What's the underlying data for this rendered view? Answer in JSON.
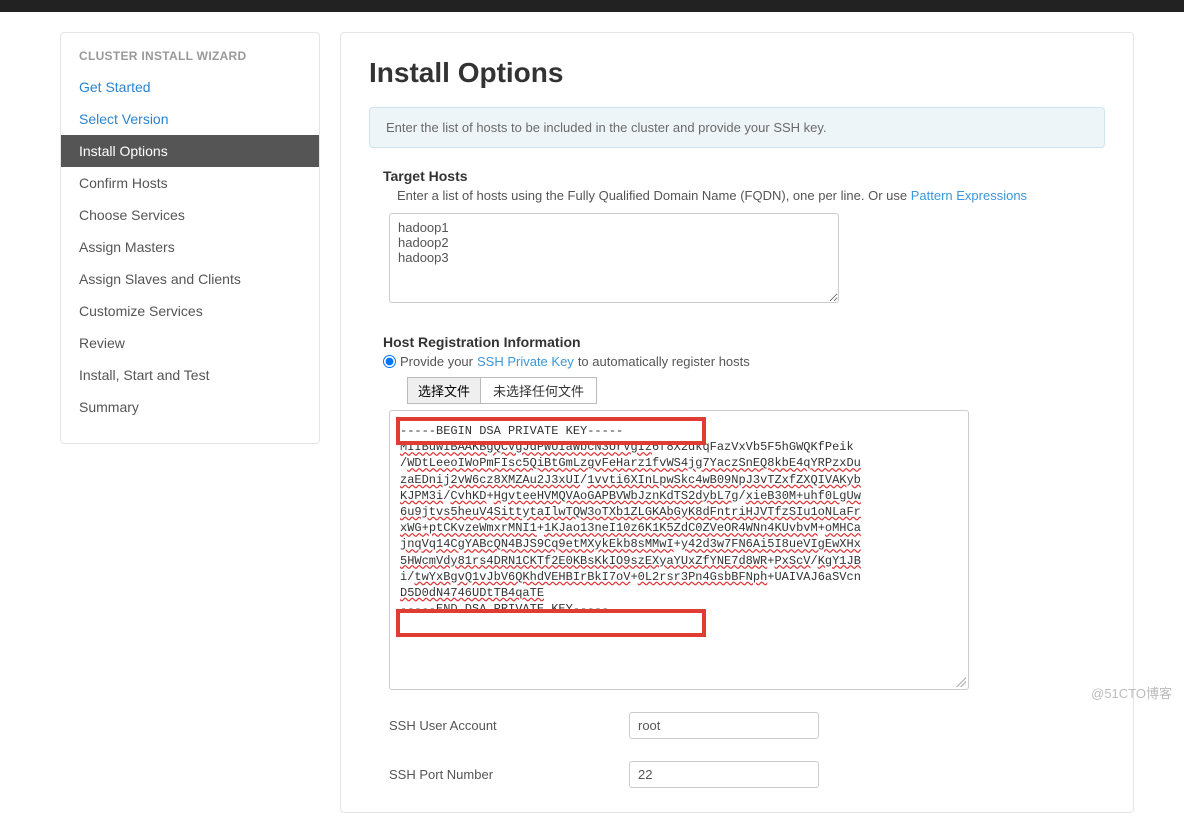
{
  "sidebar": {
    "title": "CLUSTER INSTALL WIZARD",
    "items": [
      {
        "label": "Get Started",
        "state": "link"
      },
      {
        "label": "Select Version",
        "state": "link"
      },
      {
        "label": "Install Options",
        "state": "active"
      },
      {
        "label": "Confirm Hosts",
        "state": "normal"
      },
      {
        "label": "Choose Services",
        "state": "normal"
      },
      {
        "label": "Assign Masters",
        "state": "normal"
      },
      {
        "label": "Assign Slaves and Clients",
        "state": "normal"
      },
      {
        "label": "Customize Services",
        "state": "normal"
      },
      {
        "label": "Review",
        "state": "normal"
      },
      {
        "label": "Install, Start and Test",
        "state": "normal"
      },
      {
        "label": "Summary",
        "state": "normal"
      }
    ]
  },
  "page": {
    "title": "Install Options",
    "info": "Enter the list of hosts to be included in the cluster and provide your SSH key."
  },
  "target_hosts": {
    "label": "Target Hosts",
    "desc_prefix": "Enter a list of hosts using the Fully Qualified Domain Name (FQDN), one per line. Or use ",
    "desc_link": "Pattern Expressions",
    "value": "hadoop1\nhadoop2\nhadoop3"
  },
  "host_reg": {
    "label": "Host Registration Information",
    "radio_prefix": "Provide your ",
    "radio_link": "SSH Private Key",
    "radio_suffix": " to automatically register hosts",
    "file_button": "选择文件",
    "file_status": "未选择任何文件",
    "key_begin": "-----BEGIN DSA PRIVATE KEY-----",
    "key_line1a": "MIIBuwIBAAKBgQCVgJdPWUIaWbcN3UrVgIz",
    "key_line1b": "6f8X2dkqFazVxVb5F5hGWQKfPeik",
    "key_line2a": "/",
    "key_line2b": "WDtLeeoIWoPmFIsc5QiBtGmLzgvFeHarz1fvWS4jg7YaczSnEQ8kbE4qYRPzxDu",
    "key_line3a": "zaEDnij2vW6cz8XMZAu2J3xUI",
    "key_line3b": "/",
    "key_line3c": "1vvti6XInLpwSkc4wB09NpJ3vTZxfZXQIVAKyb",
    "key_line4a": "KJPM3i",
    "key_line4b": "/",
    "key_line4c": "CvhKD",
    "key_line4d": "+",
    "key_line4e": "HgvteeHVMQVAoGAPBVWbJznKdTS2dybL7g",
    "key_line4f": "/",
    "key_line4g": "xieB30M+uhf0LgUw",
    "key_line5": "6u9jtvs5heuV4SittytaIlwTQW3oTXb1ZLGKAbGyK8dFntriHJVTfzSIu1oNLaFr",
    "key_line6a": "xWG+",
    "key_line6b": "ptCKvzeWmxrMNI1",
    "key_line6c": "+",
    "key_line6d": "1KJao13neI10z6K1K5ZdC0ZVeOR4WNn4KUvbvM",
    "key_line6e": "+",
    "key_line6f": "oMHCa",
    "key_line7a": "jnqVq14CgYABcQN4BJS9Cq9etMXykEkb8sMMwI",
    "key_line7b": "+",
    "key_line7c": "y42d3w7FN6Ai5I8ueVIgEwXHx",
    "key_line8a": "5HWcmVdy81rs4DRN1CKTf2E0KBsKkIO9szEXyaYUxZfYNE7d8WR",
    "key_line8b": "+",
    "key_line8c": "PxScV",
    "key_line8d": "/",
    "key_line8e": "KgY1JB",
    "key_line9a": "i/",
    "key_line9b": "twYxBgvQ1vJbV6QKhdVEHBIrBkI7oV",
    "key_line9c": "+",
    "key_line9d": "0L2rsr3Pn4GsbBFNph",
    "key_line9e": "+UAIVAJ6aSVcn",
    "key_line10": "D5D0dN4746UDtTB4qaTE",
    "key_end": "-----END DSA PRIVATE KEY-----"
  },
  "ssh_user": {
    "label": "SSH User Account",
    "value": "root"
  },
  "ssh_port": {
    "label": "SSH Port Number",
    "value": "22"
  },
  "watermark": "@51CTO博客"
}
